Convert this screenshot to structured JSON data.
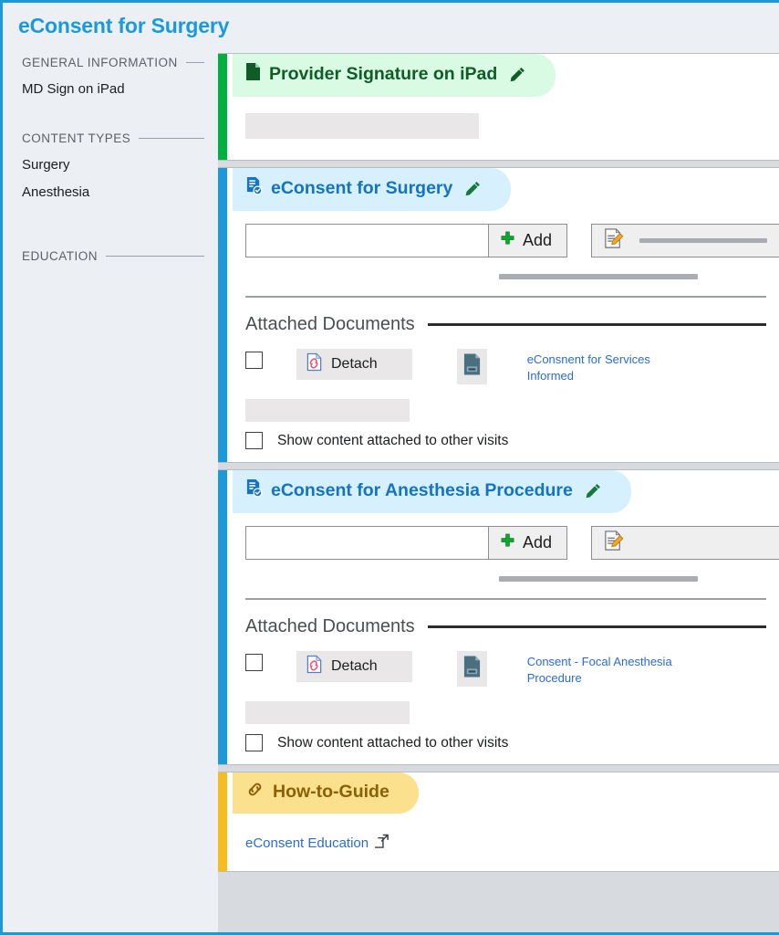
{
  "page": {
    "title": "eConsent for Surgery",
    "accent_blue": "#1a9ada",
    "accent_green": "#00b140",
    "accent_amber": "#f5bd1f",
    "link_blue": "#2b6cd4"
  },
  "sidebar": {
    "sections": [
      {
        "heading": "GENERAL INFORMATION",
        "items": [
          {
            "label": "MD Sign on iPad"
          }
        ]
      },
      {
        "heading": "CONTENT TYPES",
        "items": [
          {
            "label": "Surgery"
          },
          {
            "label": "Anesthesia"
          }
        ]
      },
      {
        "heading": "EDUCATION",
        "items": []
      }
    ]
  },
  "panels": [
    {
      "id": "provider-signature",
      "accent": "green",
      "icon": "document-icon",
      "title": "Provider Signature on iPad",
      "edit_icon": "pencil-icon"
    },
    {
      "id": "econsent-surgery",
      "accent": "blue",
      "icon": "document-check-icon",
      "title": "eConsent for Surgery",
      "edit_icon": "pencil-icon",
      "add_row": {
        "input_value": "",
        "input_placeholder": "",
        "add_label": "Add",
        "add_icon": "plus-icon",
        "doc_edit_icon": "document-pencil-icon"
      },
      "attached": {
        "heading": "Attached Documents",
        "rows": [
          {
            "checkbox_checked": false,
            "detach_label": "Detach",
            "detach_icon": "page-broken-link-icon",
            "thumb_icon": "document-thumbnail-icon",
            "doc_name": "eConsnent for Services Informed"
          }
        ],
        "show_other_label": "Show content attached to other visits",
        "show_other_checked": false
      }
    },
    {
      "id": "econsent-anesthesia",
      "accent": "blue",
      "icon": "document-check-icon",
      "title": "eConsent for Anesthesia Procedure",
      "edit_icon": "pencil-icon",
      "add_row": {
        "input_value": "",
        "input_placeholder": "",
        "add_label": "Add",
        "add_icon": "plus-icon",
        "doc_edit_icon": "document-pencil-icon"
      },
      "attached": {
        "heading": "Attached Documents",
        "rows": [
          {
            "checkbox_checked": false,
            "detach_label": "Detach",
            "detach_icon": "page-broken-link-icon",
            "thumb_icon": "document-thumbnail-icon",
            "doc_name": "Consent - Focal Anesthesia Procedure"
          }
        ],
        "show_other_label": "Show content attached to other visits",
        "show_other_checked": false
      }
    },
    {
      "id": "how-to-guide",
      "accent": "amber",
      "icon": "link-chain-icon",
      "title": "How-to-Guide",
      "links": [
        {
          "label": "eConsent Education",
          "icon": "external-link-icon"
        }
      ]
    }
  ]
}
